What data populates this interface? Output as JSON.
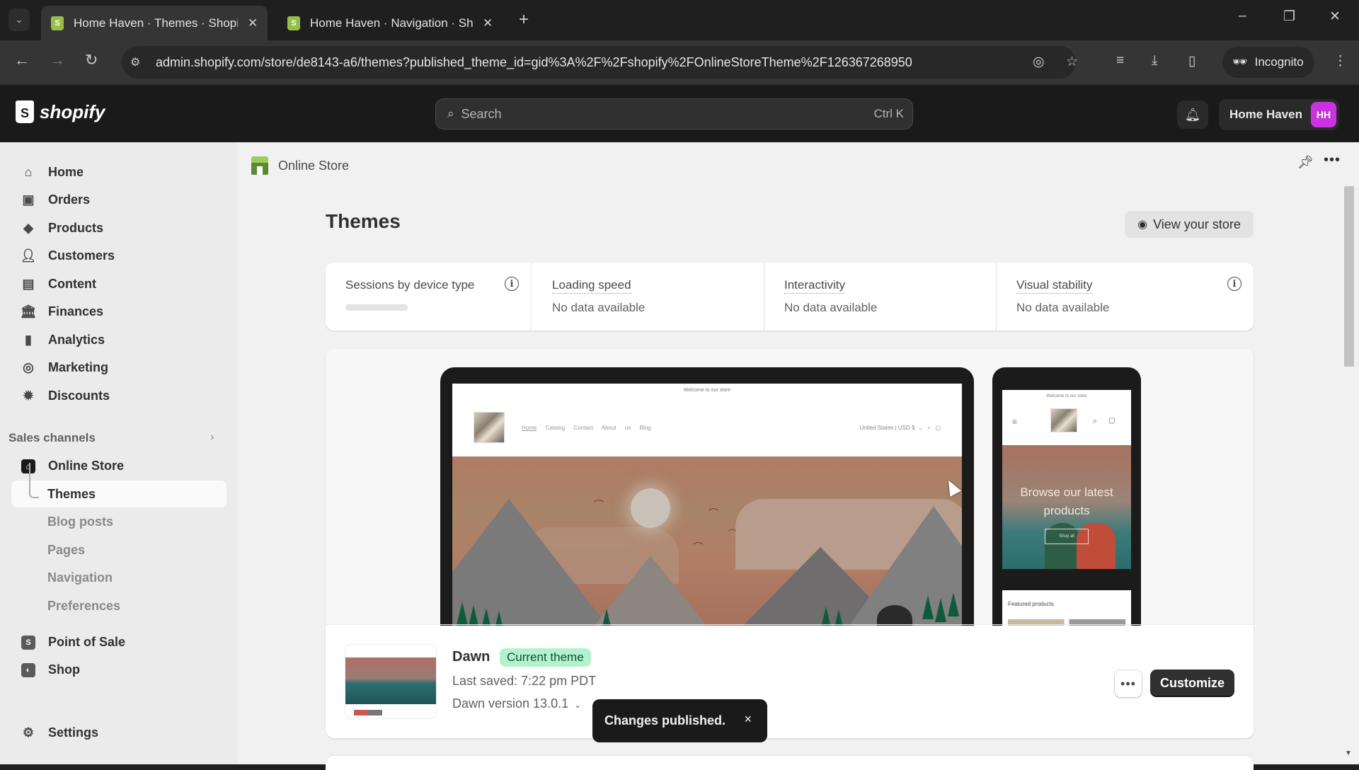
{
  "browser": {
    "tabs": [
      {
        "title": "Home Haven · Themes · Shopify",
        "active": true
      },
      {
        "title": "Home Haven · Navigation · Shopify",
        "active": false
      }
    ],
    "url": "admin.shopify.com/store/de8143-a6/themes?published_theme_id=gid%3A%2F%2Fshopify%2FOnlineStoreTheme%2F126367268950",
    "incognito_label": "Incognito"
  },
  "header": {
    "logo_text": "shopify",
    "search_placeholder": "Search",
    "search_shortcut": "Ctrl K",
    "store_name": "Home Haven",
    "avatar_initials": "HH",
    "avatar_color": "#c933e0"
  },
  "sidebar": {
    "items": [
      {
        "label": "Home",
        "icon": "home-icon"
      },
      {
        "label": "Orders",
        "icon": "orders-icon"
      },
      {
        "label": "Products",
        "icon": "tag-icon"
      },
      {
        "label": "Customers",
        "icon": "person-icon"
      },
      {
        "label": "Content",
        "icon": "content-icon"
      },
      {
        "label": "Finances",
        "icon": "bank-icon"
      },
      {
        "label": "Analytics",
        "icon": "bar-chart-icon"
      },
      {
        "label": "Marketing",
        "icon": "target-icon"
      },
      {
        "label": "Discounts",
        "icon": "discount-icon"
      }
    ],
    "sales_channels_label": "Sales channels",
    "online_store_label": "Online Store",
    "online_store_subitems": [
      "Themes",
      "Blog posts",
      "Pages",
      "Navigation",
      "Preferences"
    ],
    "active_subitem": "Themes",
    "other_channels": [
      {
        "label": "Point of Sale",
        "icon": "pos-icon"
      },
      {
        "label": "Shop",
        "icon": "shop-icon"
      }
    ],
    "settings_label": "Settings"
  },
  "main": {
    "breadcrumb": "Online Store",
    "title": "Themes",
    "view_store_label": "View your store",
    "metrics": [
      {
        "label": "Sessions by device type",
        "value": ""
      },
      {
        "label": "Loading speed",
        "value": "No data available"
      },
      {
        "label": "Interactivity",
        "value": "No data available"
      },
      {
        "label": "Visual stability",
        "value": "No data available"
      }
    ],
    "preview": {
      "desktop_announcement": "Welcome to our store",
      "desktop_menu": [
        "Home",
        "Catalog",
        "Contact",
        "About us",
        "Blog"
      ],
      "desktop_locale": "United States | USD $",
      "mobile_announcement": "Welcome to our store",
      "mobile_hero_text": "Browse our latest products",
      "mobile_hero_button": "Shop all",
      "mobile_featured": "Featured products"
    },
    "current_theme": {
      "name": "Dawn",
      "badge": "Current theme",
      "last_saved": "Last saved: 7:22 pm PDT",
      "version": "Dawn version 13.0.1",
      "customize_label": "Customize",
      "more_label": "•••"
    }
  },
  "toast": {
    "message": "Changes published.",
    "close": "×"
  }
}
